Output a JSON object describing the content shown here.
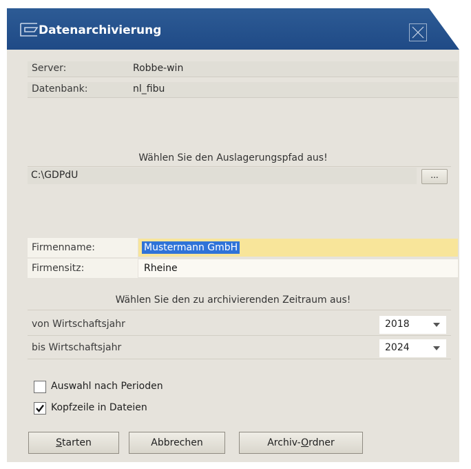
{
  "window": {
    "title": "Datenarchivierung"
  },
  "server": {
    "label": "Server:",
    "value": "Robbe-win"
  },
  "database": {
    "label": "Datenbank:",
    "value": "nl_fibu"
  },
  "path_section": {
    "heading": "Wählen Sie den Auslagerungspfad aus!",
    "value": "C:\\GDPdU",
    "browse_label": "..."
  },
  "company": {
    "name_label": "Firmenname:",
    "name_value": "Mustermann GmbH",
    "seat_label": "Firmensitz:",
    "seat_value": "Rheine"
  },
  "period_section": {
    "heading": "Wählen Sie den zu archivierenden Zeitraum aus!",
    "from_label": "von Wirtschaftsjahr",
    "from_value": "2018",
    "to_label": "bis Wirtschaftsjahr",
    "to_value": "2024"
  },
  "options": {
    "by_period": {
      "label": "Auswahl nach Perioden",
      "checked": false
    },
    "header_line": {
      "label": "Kopfzeile in Dateien",
      "checked": true
    }
  },
  "buttons": {
    "start": {
      "underline": "S",
      "rest": "tarten"
    },
    "cancel": {
      "label": "Abbrechen"
    },
    "archive": {
      "prefix": "Archiv-",
      "underline": "O",
      "rest": "rdner"
    }
  },
  "colors": {
    "titlebar": "#1f4a86",
    "dialog_bg": "#e6e3dc",
    "highlight_field": "#f8e59a",
    "selection": "#2f73d8"
  }
}
